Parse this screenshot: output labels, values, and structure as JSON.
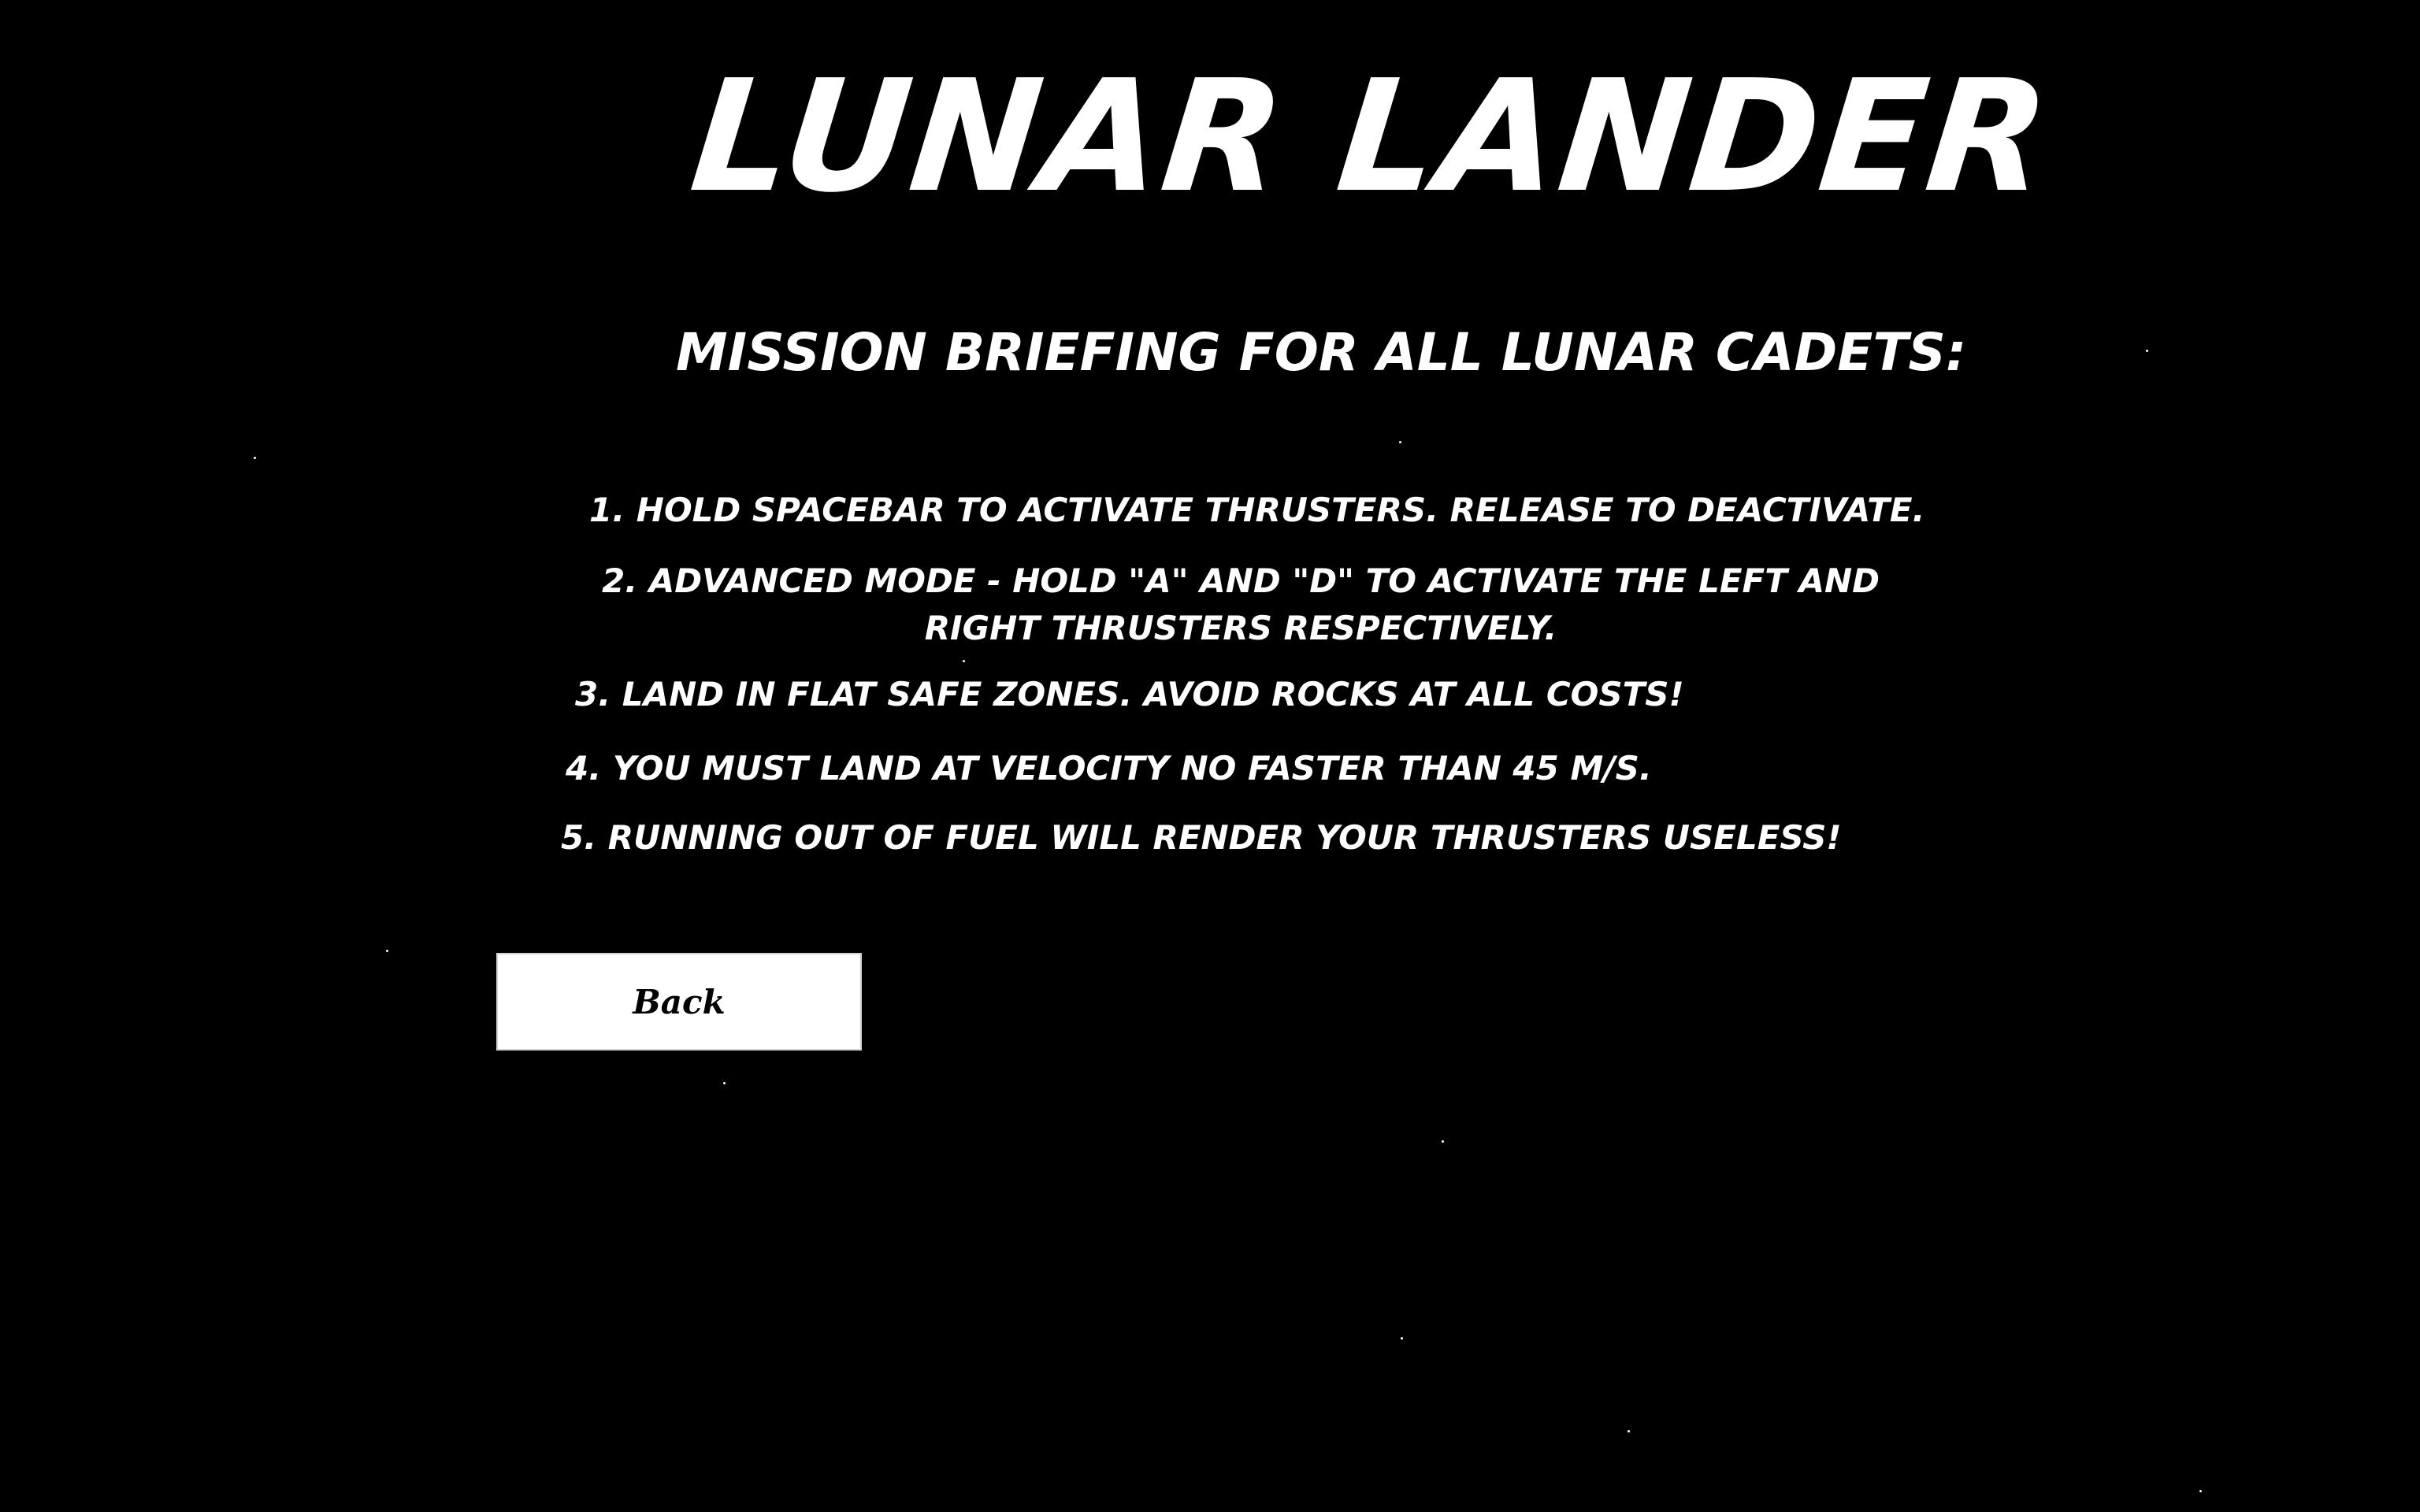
{
  "title": "LUNAR LANDER",
  "subtitle": "MISSION BRIEFING FOR ALL LUNAR CADETS:",
  "rules": [
    "1. HOLD SPACEBAR TO ACTIVATE THRUSTERS. RELEASE TO DEACTIVATE.",
    "2. ADVANCED MODE - HOLD \"A\" AND \"D\" TO ACTIVATE THE LEFT AND RIGHT THRUSTERS RESPECTIVELY.",
    "3. LAND IN FLAT SAFE ZONES. AVOID ROCKS AT ALL COSTS!",
    "4.  YOU MUST LAND AT VELOCITY NO FASTER THAN 45 M/S.",
    "5. RUNNING OUT OF FUEL WILL RENDER YOUR THRUSTERS USELESS!"
  ],
  "back_button": {
    "label": "Back"
  },
  "colors": {
    "background": "#000000",
    "text": "#ffffff",
    "button_bg": "#ffffff",
    "button_text": "#000000"
  }
}
